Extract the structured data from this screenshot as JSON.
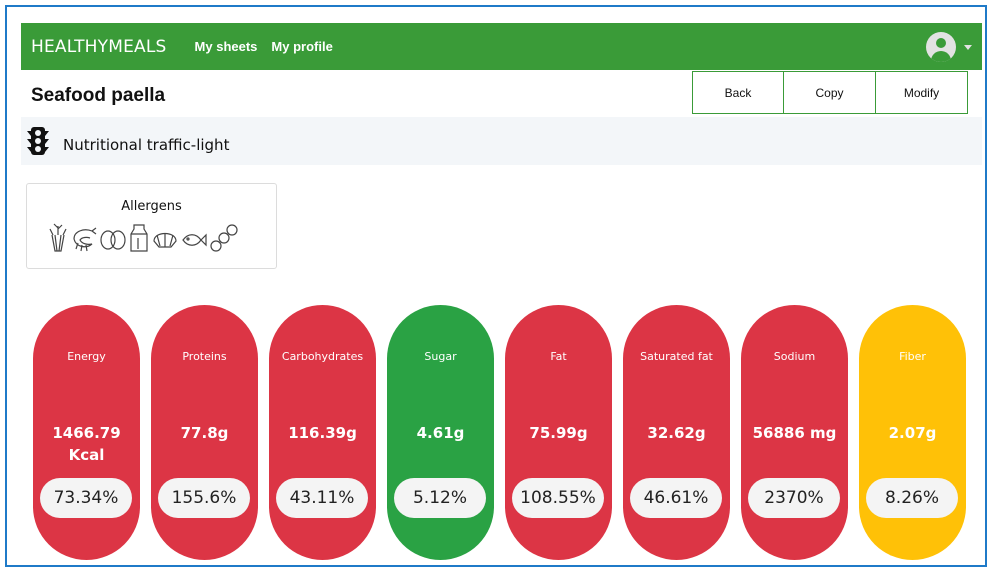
{
  "navbar": {
    "brand": "HEALTHYMEALS",
    "links": [
      "My sheets",
      "My profile"
    ],
    "color": "#3a9b38",
    "avatar_icon": "user-circle-icon"
  },
  "recipe": {
    "title": "Seafood paella",
    "buttons": [
      "Back",
      "Copy",
      "Modify"
    ]
  },
  "traffic_light": {
    "label": "Nutritional traffic-light",
    "icon": "traffic-light-icon"
  },
  "allergens": {
    "title": "Allergens",
    "icons": [
      "celery-icon",
      "crustacean-icon",
      "egg-icon",
      "milk-icon",
      "mollusc-icon",
      "fish-icon",
      "sulphite-icon"
    ]
  },
  "nutrients": [
    {
      "label": "Energy",
      "value": "1466.79 Kcal",
      "percent": "73.34%",
      "status": "red"
    },
    {
      "label": "Proteins",
      "value": "77.8g",
      "percent": "155.6%",
      "status": "red"
    },
    {
      "label": "Carbohydrates",
      "value": "116.39g",
      "percent": "43.11%",
      "status": "red"
    },
    {
      "label": "Sugar",
      "value": "4.61g",
      "percent": "5.12%",
      "status": "green"
    },
    {
      "label": "Fat",
      "value": "75.99g",
      "percent": "108.55%",
      "status": "red"
    },
    {
      "label": "Saturated fat",
      "value": "32.62g",
      "percent": "46.61%",
      "status": "red"
    },
    {
      "label": "Sodium",
      "value": "56886 mg",
      "percent": "2370%",
      "status": "red"
    },
    {
      "label": "Fiber",
      "value": "2.07g",
      "percent": "8.26%",
      "status": "yellow"
    }
  ],
  "colors": {
    "red": "#dc3545",
    "green": "#2aa244",
    "yellow": "#ffc107"
  }
}
